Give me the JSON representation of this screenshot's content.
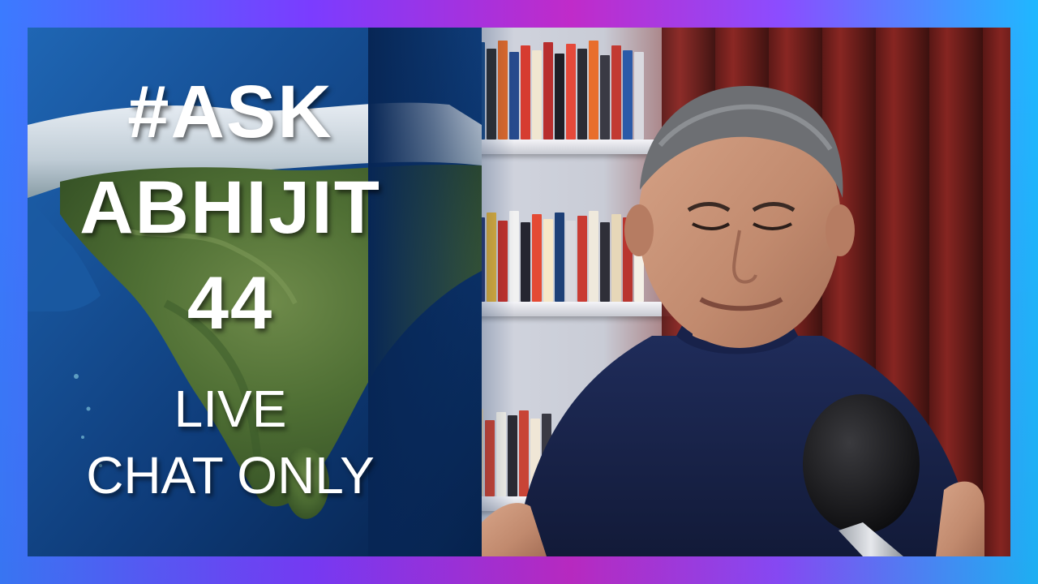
{
  "overlay": {
    "line1": "#ASK",
    "line2": "ABHIJIT",
    "line3": "44",
    "line4": "LIVE",
    "line5": "CHAT ONLY"
  },
  "colors": {
    "frame_gradient": [
      "#3b7bff",
      "#7b3cff",
      "#c02bc9",
      "#8c4cff",
      "#1fb8ff"
    ],
    "text": "#ffffff",
    "shirt": "#1b2852"
  }
}
